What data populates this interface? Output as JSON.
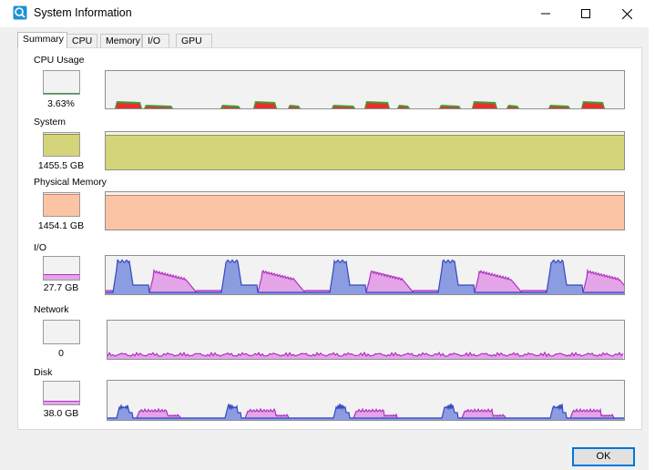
{
  "window": {
    "title": "System Information",
    "icon": "system-info-icon"
  },
  "tabs": [
    {
      "label": "Summary",
      "active": true
    },
    {
      "label": "CPU",
      "active": false
    },
    {
      "label": "Memory",
      "active": false
    },
    {
      "label": "I/O",
      "active": false
    },
    {
      "label": "GPU",
      "active": false
    }
  ],
  "sections": {
    "cpu": {
      "label": "CPU Usage",
      "value": "3.63%",
      "fill": 0.04
    },
    "system": {
      "label": "System",
      "value": "1455.5 GB",
      "fill": 1.0,
      "color": "#d4d47a"
    },
    "physical_memory": {
      "label": "Physical Memory",
      "value": "1454.1 GB",
      "fill": 1.0,
      "color": "#fbc4a4"
    },
    "io": {
      "label": "I/O",
      "value": "27.7  GB",
      "fill": 0.2
    },
    "network": {
      "label": "Network",
      "value": "0",
      "fill": 0.0
    },
    "disk": {
      "label": "Disk",
      "value": "38.0  GB",
      "fill": 0.15
    }
  },
  "colors": {
    "kernel": "#e8312a",
    "total": "#3aa03a",
    "read": "#8c9ce0",
    "read_stroke": "#3548c0",
    "write": "#e3a4e8",
    "write_stroke": "#b030c0"
  },
  "buttons": {
    "ok": "OK"
  }
}
